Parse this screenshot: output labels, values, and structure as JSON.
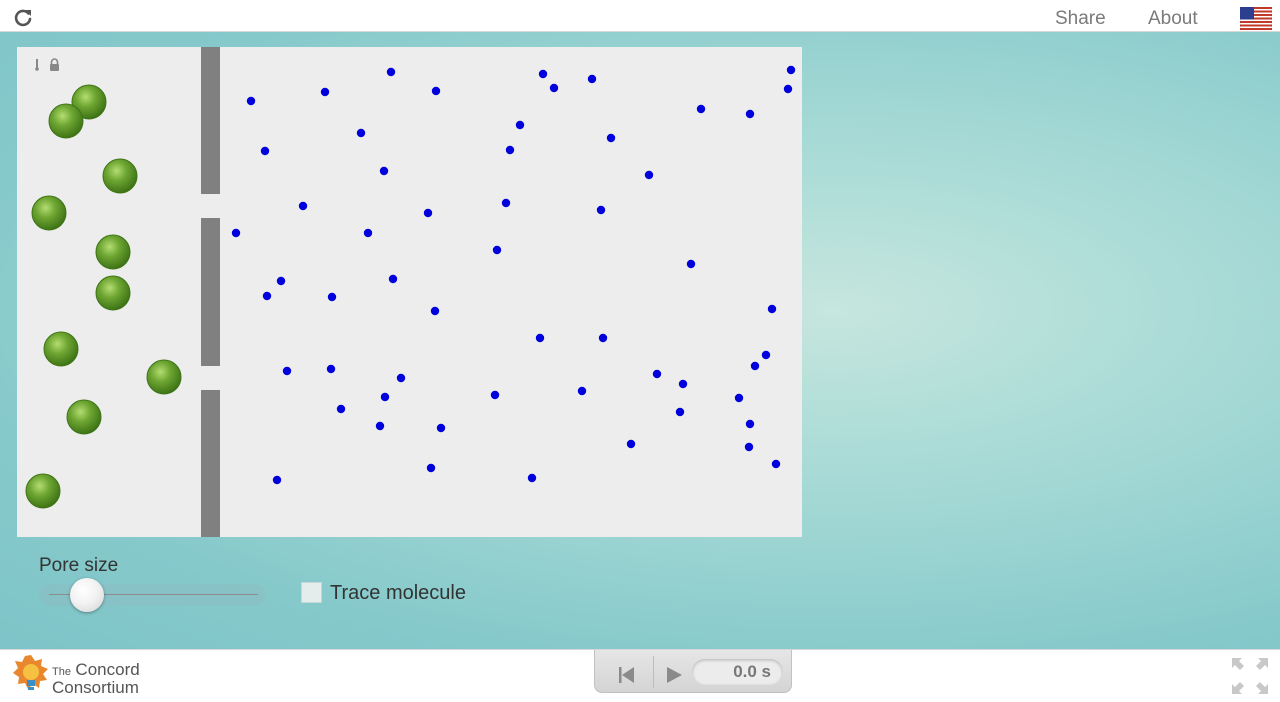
{
  "topbar": {
    "reload_icon": "reload-icon",
    "share_label": "Share",
    "about_label": "About",
    "flag_icon": "us-flag-icon"
  },
  "model": {
    "background": "#ededed",
    "wall_color": "#808080",
    "molecule_color": "#0000dd",
    "sphere_color": "#5e9e2a",
    "icons": [
      "thermometer-icon",
      "lock-icon"
    ]
  },
  "controls": {
    "pore_size_label": "Pore size",
    "pore_size_value": 0.22,
    "trace_label": "Trace molecule",
    "trace_checked": false
  },
  "footer": {
    "logo_small": "The",
    "logo_line1": "Concord",
    "logo_line2": "Consortium",
    "time_display": "0.0 s",
    "reset_icon": "skip-back-icon",
    "play_icon": "play-icon",
    "fullscreen_icon": "fullscreen-icon"
  }
}
